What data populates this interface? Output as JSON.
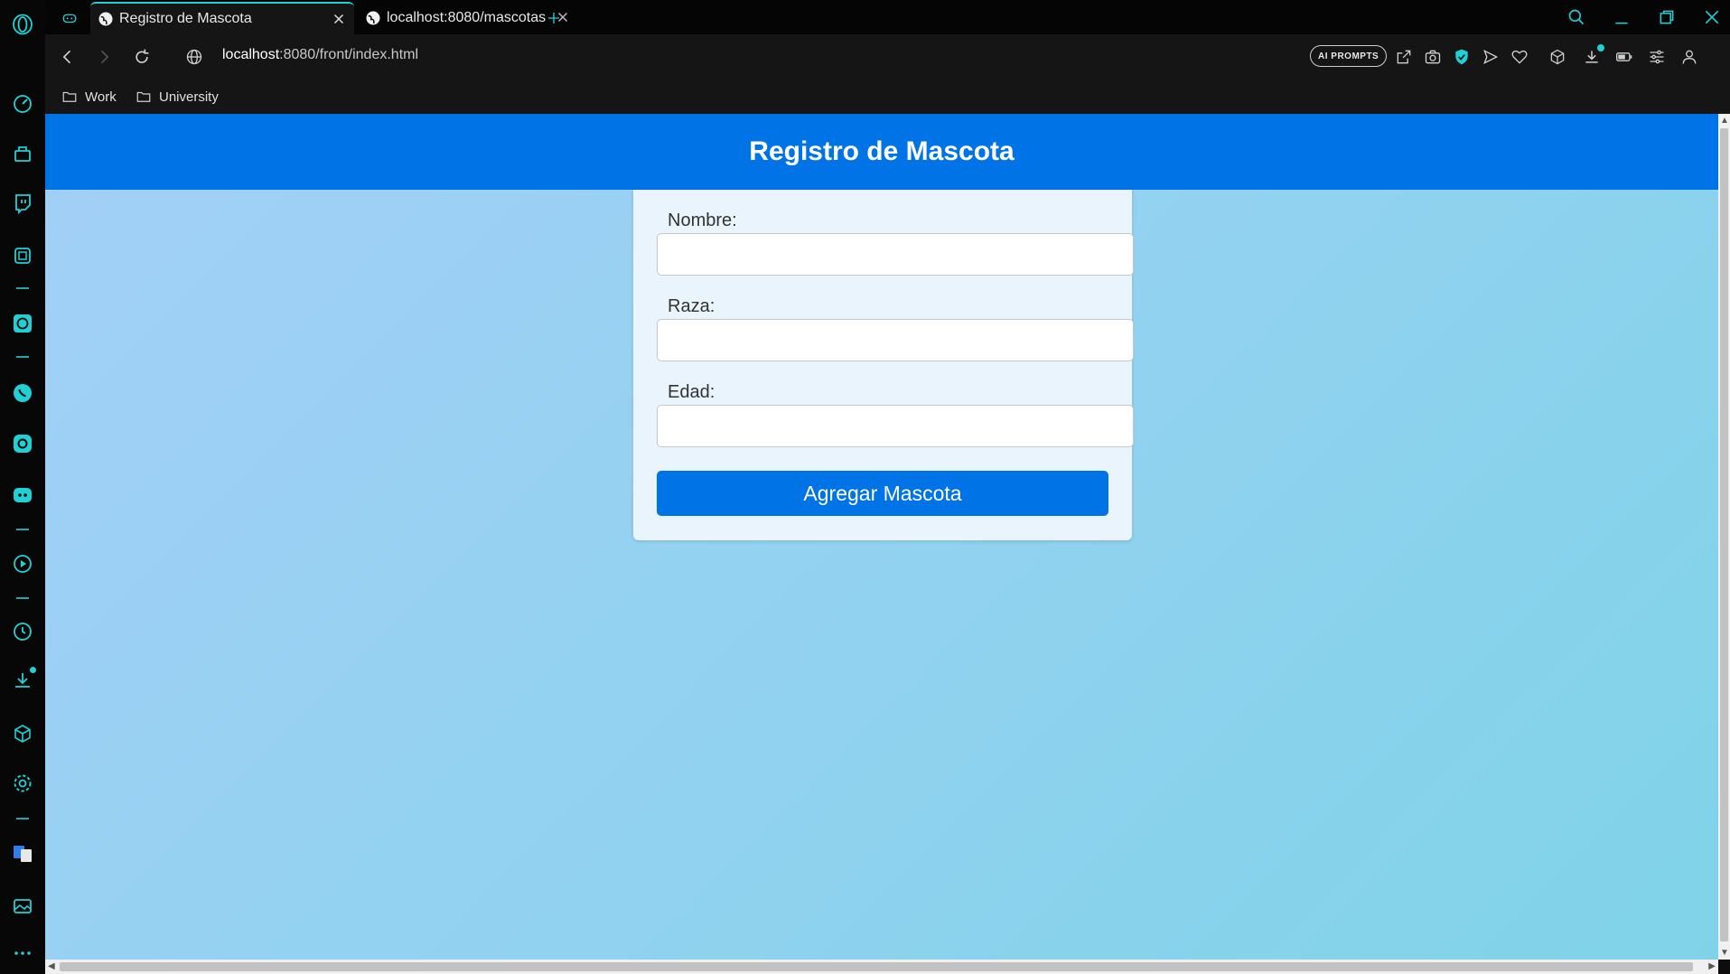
{
  "browser": {
    "tabs": [
      {
        "label": "Registro de Mascota",
        "active": true
      },
      {
        "label": "localhost:8080/mascotas",
        "active": false
      }
    ],
    "url_host": "localhost",
    "url_rest": ":8080/front/index.html",
    "ai_prompts_label": "AI PROMPTS",
    "bookmarks": [
      "Work",
      "University"
    ],
    "accent_color": "#1fd1d6",
    "sidebar_icons": [
      "opera-logo-icon",
      "speed-dial-icon",
      "gx-corner-icon",
      "twitch-icon",
      "gx-control-icon",
      "chatgpt-icon",
      "whatsapp-icon",
      "instagram-icon",
      "discord-icon",
      "player-icon",
      "history-icon",
      "downloads-icon",
      "extensions-icon",
      "settings-icon",
      "translate-icon",
      "gallery-icon",
      "more-icon"
    ]
  },
  "page": {
    "title": "Registro de Mascota",
    "header_color": "#0073e6",
    "fields": [
      {
        "label": "Nombre:",
        "value": ""
      },
      {
        "label": "Raza:",
        "value": ""
      },
      {
        "label": "Edad:",
        "value": ""
      }
    ],
    "submit_label": "Agregar Mascota"
  }
}
